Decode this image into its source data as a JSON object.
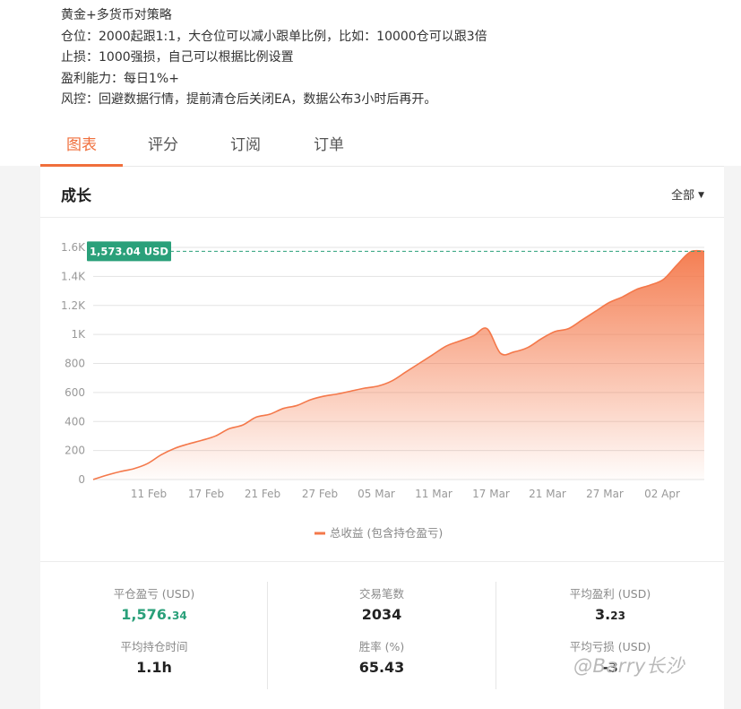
{
  "description": {
    "lines": [
      "黄金+多货币对策略",
      "仓位：2000起跟1:1，大仓位可以减小跟单比例，比如：10000仓可以跟3倍",
      "止损：1000强损，自己可以根据比例设置",
      "盈利能力：每日1%+",
      "风控：回避数据行情，提前清仓后关闭EA，数据公布3小时后再开。"
    ]
  },
  "tabs": [
    "图表",
    "评分",
    "订阅",
    "订单"
  ],
  "active_tab": 0,
  "panel": {
    "title": "成长",
    "range_label": "全部"
  },
  "chart_data": {
    "type": "area",
    "current_value_label": "1,573.04 USD",
    "current_value": 1573.04,
    "y_ticks": [
      "0",
      "200",
      "400",
      "600",
      "800",
      "1K",
      "1.2K",
      "1.4K",
      "1.6K"
    ],
    "y_tick_values": [
      0,
      200,
      400,
      600,
      800,
      1000,
      1200,
      1400,
      1600
    ],
    "x_ticks": [
      "11 Feb",
      "17 Feb",
      "21 Feb",
      "27 Feb",
      "05 Mar",
      "11 Mar",
      "17 Mar",
      "21 Mar",
      "27 Mar",
      "02 Apr"
    ],
    "ylim": [
      0,
      1600
    ],
    "legend": "总收益 (包含持仓盈亏)",
    "legend_position": "bottom-center",
    "grid": true,
    "colors": {
      "line": "#f4784a",
      "fill_top": "#f4784a",
      "marker": "#2aa07a"
    },
    "series": [
      {
        "values": [
          0,
          30,
          55,
          75,
          110,
          170,
          215,
          245,
          270,
          300,
          350,
          375,
          430,
          450,
          490,
          510,
          550,
          575,
          590,
          610,
          630,
          645,
          680,
          740,
          800,
          860,
          920,
          955,
          990,
          1040,
          870,
          880,
          910,
          970,
          1020,
          1040,
          1100,
          1160,
          1220,
          1260,
          1310,
          1340,
          1380,
          1480,
          1570,
          1573
        ]
      }
    ]
  },
  "stats": {
    "closed_pnl_label": "平仓盈亏 (USD)",
    "closed_pnl_main": "1,576.",
    "closed_pnl_dec": "34",
    "trades_label": "交易笔数",
    "trades_value": "2034",
    "avg_profit_label": "平均盈利 (USD)",
    "avg_profit_main": "3.",
    "avg_profit_dec": "23",
    "avg_hold_label": "平均持仓时间",
    "avg_hold_value": "1.1h",
    "win_rate_label": "胜率 (%)",
    "win_rate_value": "65.43",
    "avg_loss_label": "平均亏损 (USD)",
    "avg_loss_value": "-3"
  },
  "watermark": "@Barry长沙"
}
